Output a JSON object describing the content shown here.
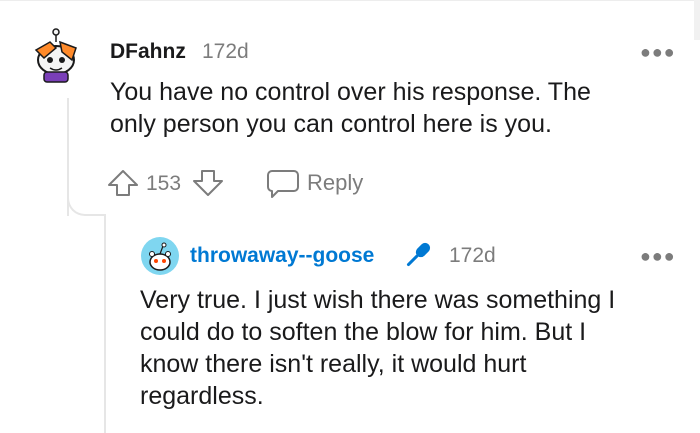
{
  "comment": {
    "username": "DFahnz",
    "timestamp": "172d",
    "text_line1": "You have no control over his response. The",
    "text_line2": "only person you can control here is you.",
    "vote_count": "153",
    "reply_label": "Reply",
    "more_icon": "more-horizontal-icon"
  },
  "reply": {
    "username": "throwaway--goose",
    "username_color": "#0079d3",
    "flair_icon": "microphone-icon",
    "timestamp": "172d",
    "text_line1": "Very true. I just wish there was something I",
    "text_line2": "could do to soften the blow for him. But I",
    "text_line3": "know there isn't really, it would hurt",
    "text_line4": "regardless.",
    "more_icon": "more-horizontal-icon"
  }
}
